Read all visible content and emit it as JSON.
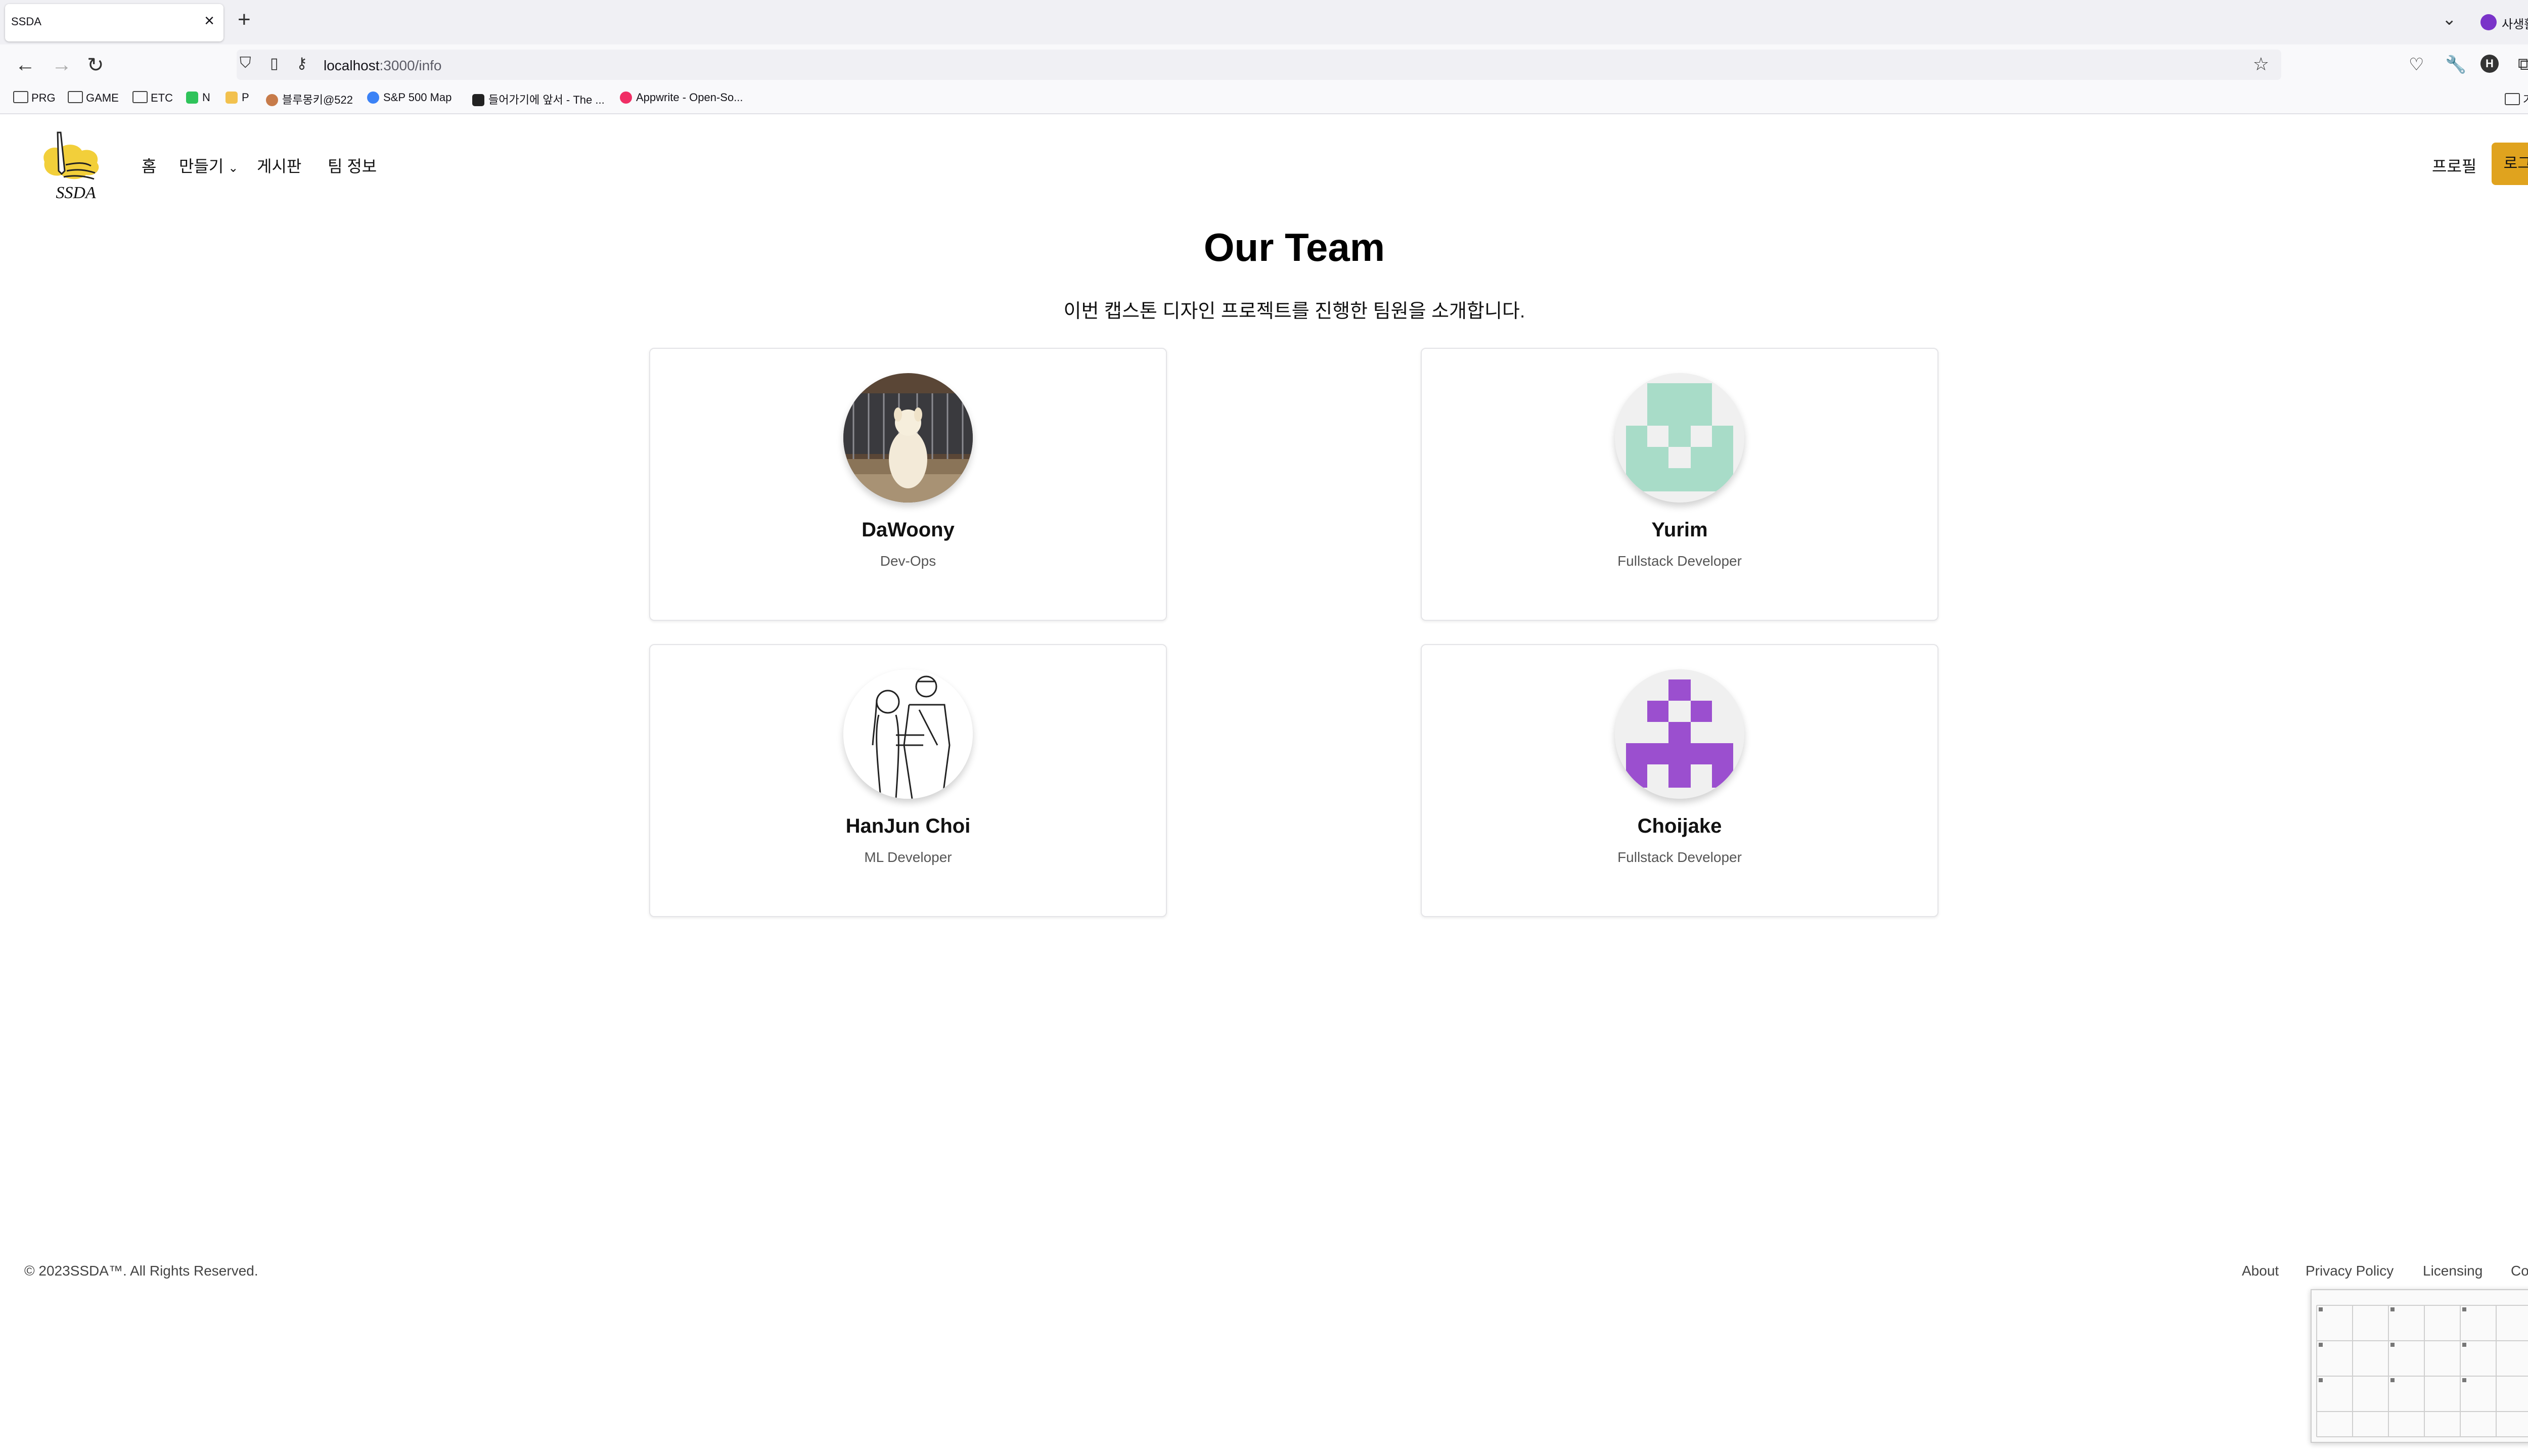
{
  "browser": {
    "tab_title": "SSDA",
    "private_label": "사생활 보호 모드",
    "url_host": "localhost",
    "url_path": ":3000/info",
    "bookmarks": [
      "PRG",
      "GAME",
      "ETC",
      "N",
      "P",
      "블루몽키@522",
      "S&P 500 Map",
      "들어가기에 앞서 - The ...",
      "Appwrite - Open-So..."
    ],
    "other_bookmarks": "기타 북마크",
    "avatar_letter": "H"
  },
  "header": {
    "logo_text": "SSDA",
    "nav": [
      "홈",
      "만들기",
      "게시판",
      "팀 정보"
    ],
    "profile": "프로필",
    "logout": "로그아웃"
  },
  "main": {
    "title": "Our Team",
    "subtitle": "이번 캡스톤 디자인 프로젝트를 진행한 팀원을 소개합니다.",
    "members": [
      {
        "name": "DaWoony",
        "role": "Dev-Ops"
      },
      {
        "name": "Yurim",
        "role": "Fullstack Developer"
      },
      {
        "name": "HanJun Choi",
        "role": "ML Developer"
      },
      {
        "name": "Choijake",
        "role": "Fullstack Developer"
      }
    ]
  },
  "footer": {
    "copyright": "© 2023SSDA™. All Rights Reserved.",
    "links": [
      "About",
      "Privacy Policy",
      "Licensing",
      "Contact"
    ]
  },
  "colors": {
    "accent": "#e0a31e",
    "identicon_mint": "#a8dcc8",
    "identicon_purple": "#9b4fcf"
  }
}
